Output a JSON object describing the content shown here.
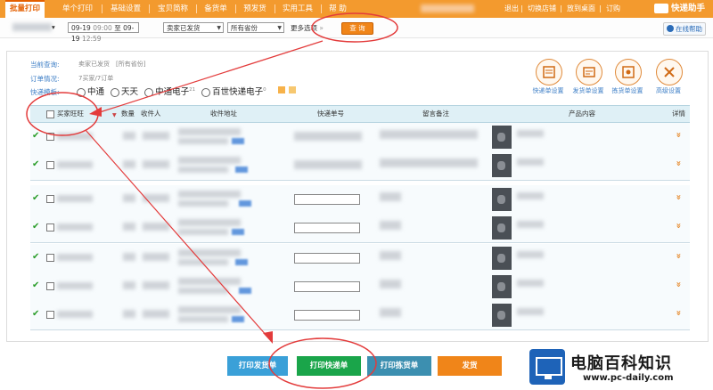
{
  "nav": {
    "tabs": [
      "批量打印",
      "单个打印",
      "基础设置",
      "宝贝简称",
      "备货单",
      "预发货",
      "实用工具",
      "帮 助"
    ],
    "active_index": 0,
    "links": [
      "退出",
      "切换店铺",
      "放到桌面",
      "订购"
    ],
    "brand": "快递助手"
  },
  "filter": {
    "date_from": "09-19",
    "time_from": "09:00",
    "to_label": "至",
    "date_to": "09-19",
    "time_to": "12:59",
    "status_value": "卖家已发货",
    "province_value": "所有省份",
    "more_label": "更多选项",
    "query_label": "查 询",
    "help_label": "在线帮助"
  },
  "summary": {
    "current_query_label": "当前查询:",
    "current_query_value": "卖家已发货",
    "current_query_extra": "[所有省份]",
    "order_status_label": "订单情况:",
    "order_status_value": "7买家/7订单",
    "express_label": "快递模板:",
    "express_options": [
      {
        "label": "中通",
        "count": ""
      },
      {
        "label": "天天",
        "count": ""
      },
      {
        "label": "中通电子",
        "count": "21"
      },
      {
        "label": "百世快递电子",
        "count": "0"
      }
    ]
  },
  "tools": [
    {
      "label": "快递单设置",
      "icon": "express-sheet-icon"
    },
    {
      "label": "发货单设置",
      "icon": "delivery-sheet-icon"
    },
    {
      "label": "拣货单设置",
      "icon": "picking-sheet-icon"
    },
    {
      "label": "高级设置",
      "icon": "tools-icon"
    }
  ],
  "table": {
    "headers": [
      "买家旺旺",
      "数量",
      "收件人",
      "收件地址",
      "快递单号",
      "留言备注",
      "产品内容",
      "详情"
    ],
    "row_count": 7
  },
  "buttons": {
    "print_delivery": "打印发货单",
    "print_express": "打印快递单",
    "print_picking": "打印拣货单",
    "ship": "发货"
  },
  "watermark": {
    "title": "电脑百科知识",
    "url": "www.pc-daily.com"
  },
  "colors": {
    "nav_orange": "#f39a2e",
    "table_header": "#dff0f6",
    "btn_blue": "#3aa0d8",
    "btn_green": "#1aa54a",
    "btn_teal": "#3c8fb0",
    "btn_orange": "#f08519",
    "annotation_red": "#e33b3b"
  }
}
